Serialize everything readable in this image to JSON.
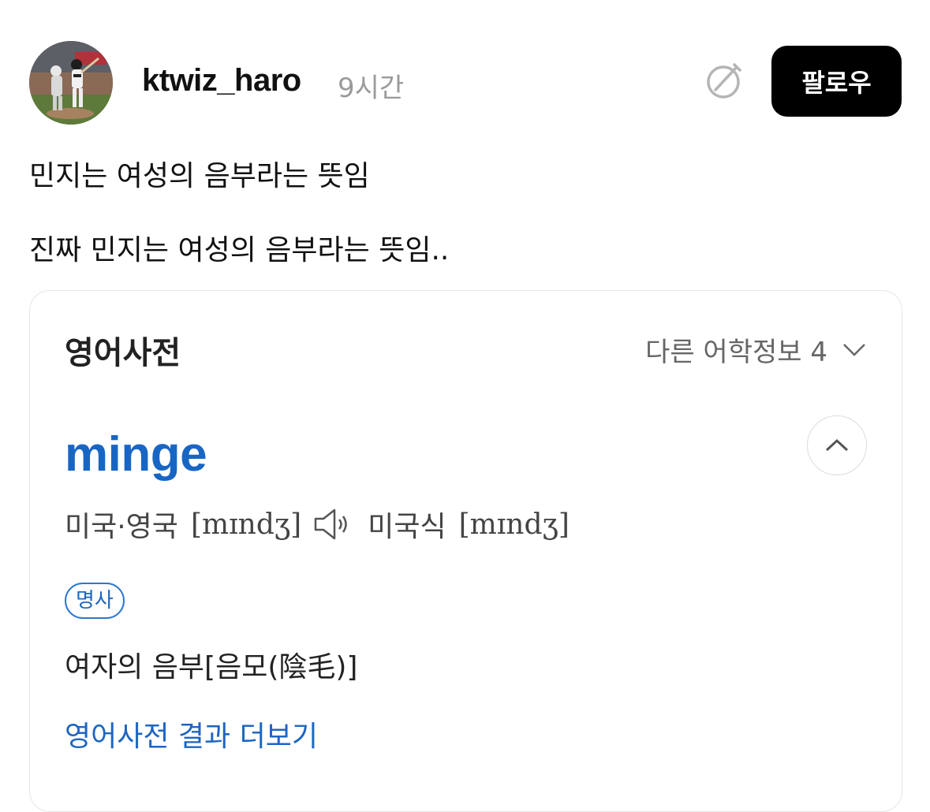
{
  "post": {
    "username": "ktwiz_haro",
    "timestamp": "9시간",
    "follow_label": "팔로우",
    "lines": [
      "민지는 여성의 음부라는 뜻임",
      "진짜 민지는 여성의 음부라는 뜻임.."
    ]
  },
  "dictionary": {
    "title": "영어사전",
    "more_info": "다른 어학정보 4",
    "word": "minge",
    "pron_uk_us_label": "미국·영국",
    "pron_uk_us_ipa": "[mɪndʒ]",
    "pron_us_label": "미국식",
    "pron_us_ipa": "[mɪndʒ]",
    "part_of_speech": "명사",
    "definition": "여자의 음부[음모(陰毛)]",
    "more_link": "영어사전 결과 더보기"
  },
  "icons": {
    "repost": "repost-icon",
    "speaker": "speaker-icon",
    "chevron_down": "chevron-down-icon",
    "chevron_up": "chevron-up-icon"
  },
  "colors": {
    "follow_bg": "#000000",
    "word": "#1866c4",
    "link": "#1e66c0",
    "muted": "#9a9a9a"
  }
}
